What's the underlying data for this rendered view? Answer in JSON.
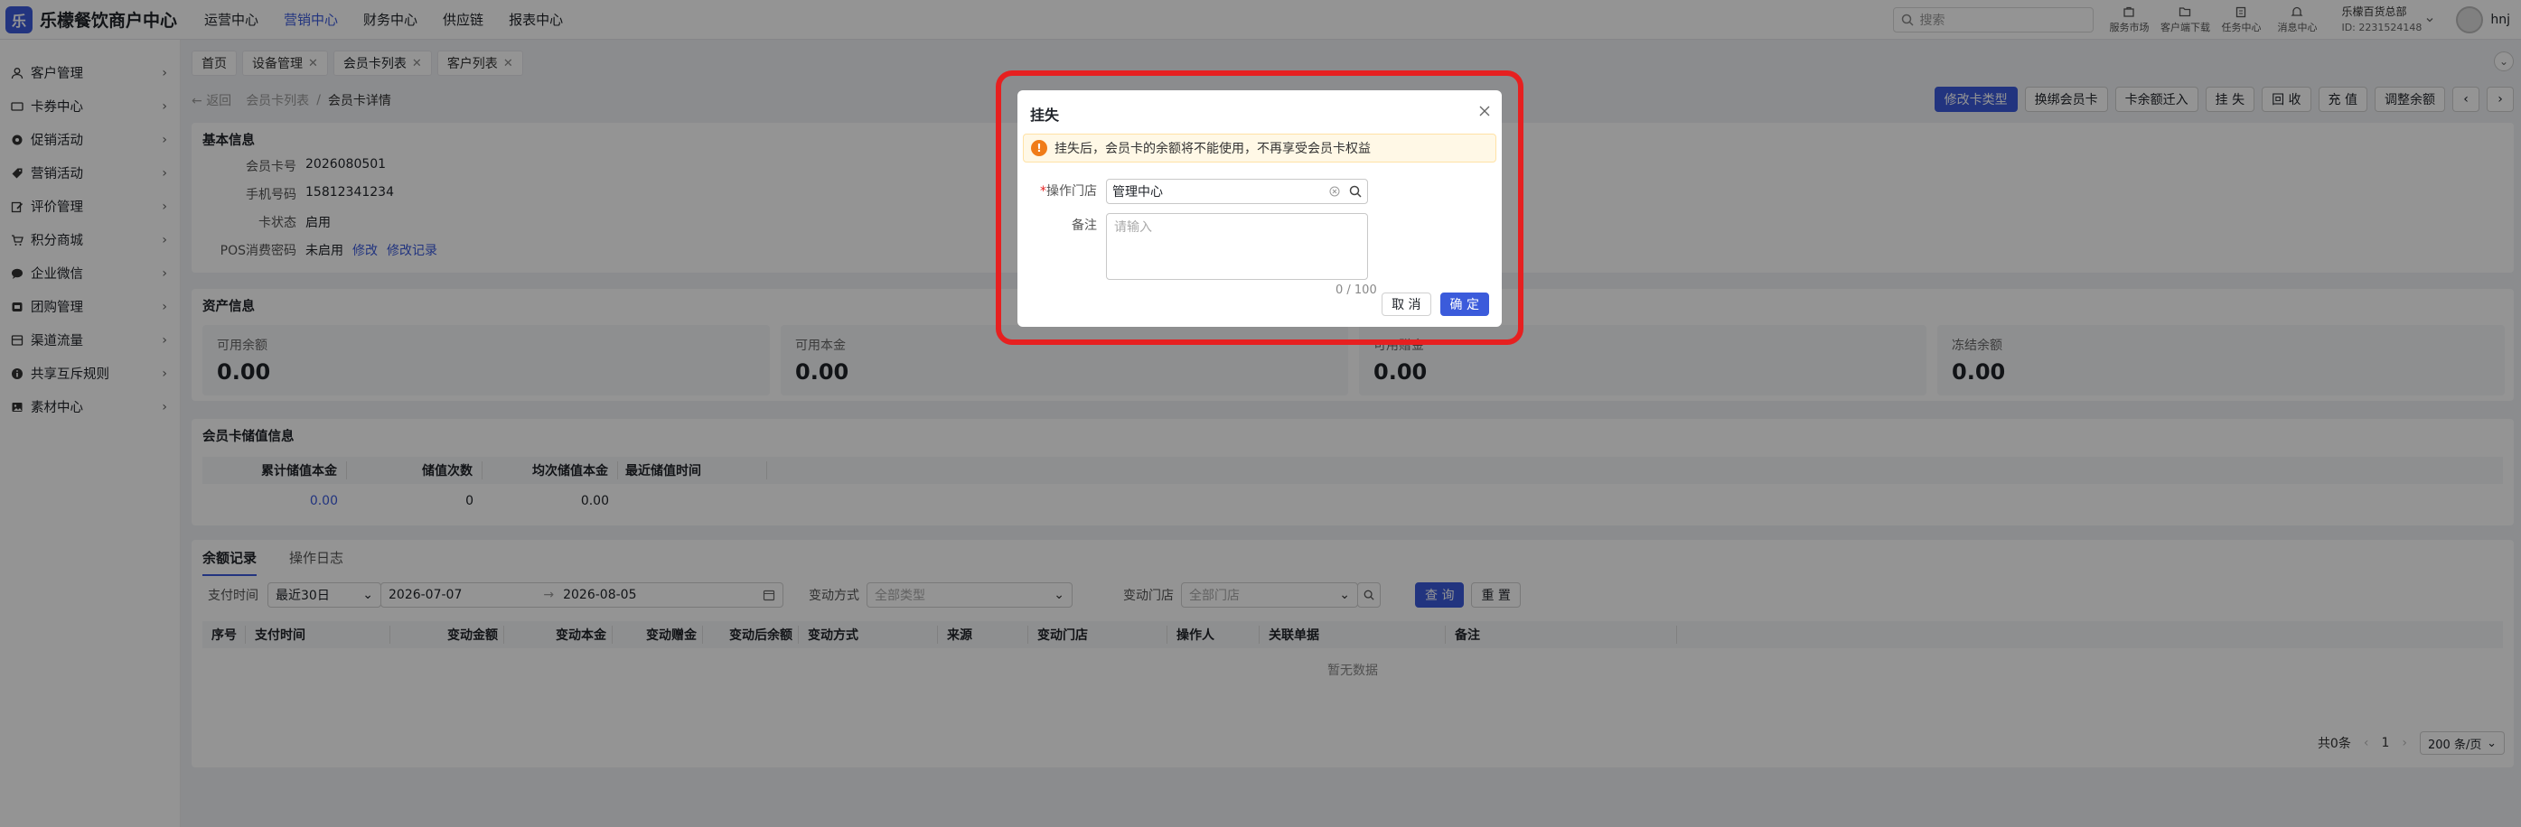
{
  "brand": {
    "name": "乐檬餐饮商户中心",
    "mark": "乐"
  },
  "topnav": [
    "运营中心",
    "营销中心",
    "财务中心",
    "供应链",
    "报表中心"
  ],
  "search": {
    "placeholder": "搜索"
  },
  "tools": [
    {
      "label": "服务市场",
      "icon": "shop-icon"
    },
    {
      "label": "客户端下载",
      "icon": "folder-icon"
    },
    {
      "label": "任务中心",
      "icon": "clipboard-icon"
    },
    {
      "label": "消息中心",
      "icon": "bell-icon"
    }
  ],
  "org": {
    "name": "乐檬百货总部",
    "id": "ID: 2231524148"
  },
  "user": {
    "name": "hnj"
  },
  "sidebar": [
    {
      "label": "客户管理",
      "icon": "user-icon"
    },
    {
      "label": "卡券中心",
      "icon": "card-icon"
    },
    {
      "label": "促销活动",
      "icon": "gear-icon"
    },
    {
      "label": "营销活动",
      "icon": "tag-icon"
    },
    {
      "label": "评价管理",
      "icon": "edit-icon"
    },
    {
      "label": "积分商城",
      "icon": "cart-icon"
    },
    {
      "label": "企业微信",
      "icon": "chat-icon"
    },
    {
      "label": "团购管理",
      "icon": "group-icon"
    },
    {
      "label": "渠道流量",
      "icon": "channel-icon"
    },
    {
      "label": "共享互斥规则",
      "icon": "info-icon"
    },
    {
      "label": "素材中心",
      "icon": "image-icon"
    }
  ],
  "tabs": [
    {
      "label": "首页",
      "closable": false
    },
    {
      "label": "设备管理",
      "closable": true
    },
    {
      "label": "会员卡列表",
      "closable": true
    },
    {
      "label": "客户列表",
      "closable": true
    }
  ],
  "breadcrumb": {
    "back": "返回",
    "parent": "会员卡列表",
    "sep": "/",
    "current": "会员卡详情"
  },
  "actions": [
    "修改卡类型",
    "换绑会员卡",
    "卡余额迁入",
    "挂 失",
    "回 收",
    "充 值",
    "调整余额"
  ],
  "basic": {
    "title": "基本信息",
    "card_no_label": "会员卡号",
    "card_no": "2026080501",
    "phone_label": "手机号码",
    "phone": "15812341234",
    "status_label": "卡状态",
    "status": "启用",
    "pos_label": "POS消费密码",
    "pos_value": "未启用",
    "pos_edit": "修改",
    "pos_log": "修改记录"
  },
  "assets": {
    "title": "资产信息",
    "items": [
      {
        "label": "可用余额",
        "value": "0.00"
      },
      {
        "label": "可用本金",
        "value": "0.00"
      },
      {
        "label": "可用赠金",
        "value": "0.00"
      },
      {
        "label": "冻结余额",
        "value": "0.00"
      }
    ]
  },
  "stored": {
    "title": "会员卡储值信息",
    "headers": [
      "累计储值本金",
      "储值次数",
      "均次储值本金",
      "最近储值时间"
    ],
    "values": [
      "0.00",
      "0",
      "0.00",
      ""
    ]
  },
  "records": {
    "tabs": [
      "余额记录",
      "操作日志"
    ],
    "pay_time_label": "支付时间",
    "period": "最近30日",
    "date_from": "2026-07-07",
    "date_to": "2026-08-05",
    "change_type_label": "变动方式",
    "change_type_ph": "全部类型",
    "store_label": "变动门店",
    "store_ph": "全部门店",
    "query": "查 询",
    "reset": "重 置",
    "headers": [
      "序号",
      "支付时间",
      "变动金额",
      "变动本金",
      "变动赠金",
      "变动后余额",
      "变动方式",
      "来源",
      "变动门店",
      "操作人",
      "关联单据",
      "备注"
    ],
    "empty": "暂无数据",
    "total": "共0条",
    "page": "1",
    "page_size": "200 条/页"
  },
  "modal": {
    "title": "挂失",
    "alert": "挂失后，会员卡的余额将不能使用，不再享受会员卡权益",
    "store_label": "操作门店",
    "store_value": "管理中心",
    "remark_label": "备注",
    "remark_placeholder": "请输入",
    "count": "0 / 100",
    "cancel": "取 消",
    "ok": "确 定"
  },
  "colors": {
    "accent": "#3b5bdb",
    "highlight": "#e62020",
    "warning": "#f07c19"
  }
}
